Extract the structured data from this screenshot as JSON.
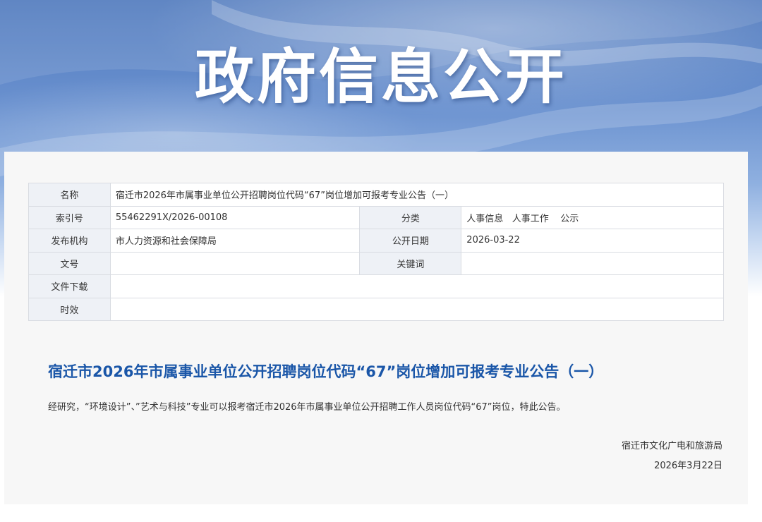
{
  "banner": {
    "title": "政府信息公开"
  },
  "meta_table": {
    "name_label": "名称",
    "name_value": "宿迁市2026年市属事业单位公开招聘岗位代码“67”岗位增加可报考专业公告（一）",
    "index_label": "索引号",
    "index_value": "55462291X/2026-00108",
    "category_label": "分类",
    "category_value": "人事信息   人事工作    公示",
    "publisher_label": "发布机构",
    "publisher_value": "市人力资源和社会保障局",
    "open_date_label": "公开日期",
    "open_date_value": "2026-03-22",
    "doc_no_label": "文号",
    "doc_no_value": "",
    "keywords_label": "关键词",
    "keywords_value": "",
    "download_label": "文件下载",
    "download_value": "",
    "validity_label": "时效",
    "validity_value": ""
  },
  "notice": {
    "title": "宿迁市2026年市属事业单位公开招聘岗位代码“67”岗位增加可报考专业公告（一）",
    "body": "经研究，“环境设计”、”艺术与科技”专业可以报考宿迁市2026年市属事业单位公开招聘工作人员岗位代码“67”岗位，特此公告。",
    "signer": "宿迁市文化广电和旅游局",
    "date": "2026年3月22日"
  }
}
